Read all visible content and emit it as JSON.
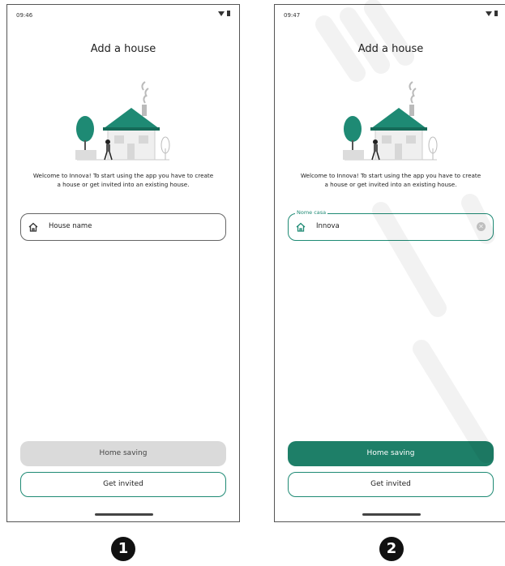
{
  "colors": {
    "accent": "#1e8a74",
    "primary_button": "#1e7f68",
    "disabled_button": "#dadada",
    "roof": "#1e8a74",
    "tree": "#1e8a74"
  },
  "screens": [
    {
      "status_time": "09:46",
      "title": "Add a house",
      "welcome_line1": "Welcome to Innova! To start using the app you have to create",
      "welcome_line2": "a house or get invited into an existing house.",
      "field": {
        "icon": "home-icon",
        "value": "",
        "placeholder": "House name",
        "label": ""
      },
      "save_label": "Home saving",
      "save_state": "disabled",
      "invite_label": "Get invited",
      "badge": "1"
    },
    {
      "status_time": "09:47",
      "title": "Add a house",
      "welcome_line1": "Welcome to Innova! To start using the app you have to create",
      "welcome_line2": "a house or get invited into an existing house.",
      "field": {
        "icon": "home-icon",
        "value": "Innova",
        "placeholder": "",
        "label": "Nome casa",
        "clear_icon": "clear-icon"
      },
      "save_label": "Home saving",
      "save_state": "active",
      "invite_label": "Get invited",
      "badge": "2"
    }
  ]
}
